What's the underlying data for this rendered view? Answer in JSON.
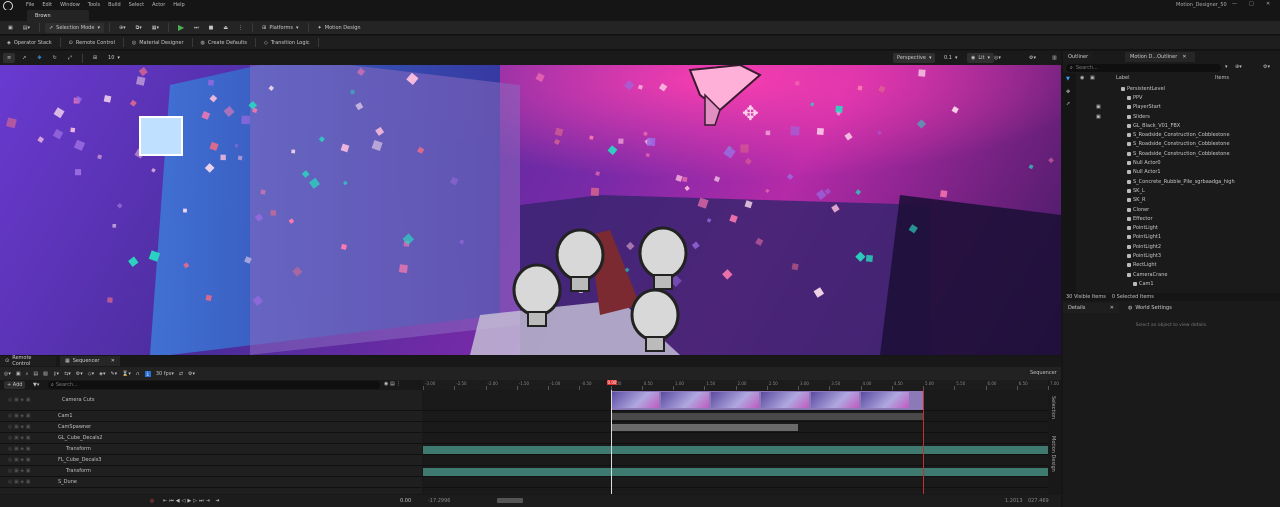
{
  "menu": [
    "File",
    "Edit",
    "Window",
    "Tools",
    "Build",
    "Select",
    "Actor",
    "Help"
  ],
  "window_title": "Motion_Designer_50",
  "doc_tab": "Brown",
  "toolbar": {
    "selection_mode": "Selection Mode",
    "platforms": "Platforms",
    "motion_design": "Motion Design"
  },
  "toolbar2": [
    "Operator Stack",
    "Remote Control",
    "Material Designer",
    "Create Defaults",
    "Transition Logic"
  ],
  "viewport": {
    "perspective": "Perspective",
    "lit": "Lit",
    "fov": "0.1",
    "grid": "10"
  },
  "outliner": {
    "tabs": [
      "Outliner",
      "Motion D...Outliner"
    ],
    "search_placeholder": "Search...",
    "col_label": "Label",
    "col_items": "Items",
    "items": [
      {
        "label": "PersistentLevel",
        "indent": 0
      },
      {
        "label": "PPV",
        "indent": 1
      },
      {
        "label": "PlayerStart",
        "indent": 1
      },
      {
        "label": "Sliders",
        "indent": 1
      },
      {
        "label": "GL_Black_V01_FBX",
        "indent": 1
      },
      {
        "label": "S_Roadside_Construction_Cobblestone",
        "indent": 1
      },
      {
        "label": "S_Roadside_Construction_Cobblestone",
        "indent": 1
      },
      {
        "label": "S_Roadside_Construction_Cobblestone",
        "indent": 1
      },
      {
        "label": "Null Actor0",
        "indent": 1
      },
      {
        "label": "Null Actor1",
        "indent": 1
      },
      {
        "label": "S_Concrete_Rubble_Pile_sgrbaadga_high",
        "indent": 1
      },
      {
        "label": "SK_L",
        "indent": 1
      },
      {
        "label": "SK_R",
        "indent": 1
      },
      {
        "label": "Cloner",
        "indent": 1
      },
      {
        "label": "Effector",
        "indent": 1
      },
      {
        "label": "PointLight",
        "indent": 1
      },
      {
        "label": "PointLight1",
        "indent": 1
      },
      {
        "label": "PointLight2",
        "indent": 1
      },
      {
        "label": "PointLight3",
        "indent": 1
      },
      {
        "label": "RectLight",
        "indent": 1
      },
      {
        "label": "CameraCrane",
        "indent": 1
      },
      {
        "label": "Cam1",
        "indent": 2
      }
    ],
    "visible_items": "30 Visible Items",
    "selected_items": "0 Selected Items"
  },
  "details": {
    "tabs": [
      "Details",
      "World Settings"
    ],
    "empty": "Select an object to view details."
  },
  "bottom_tabs": [
    "Remote Control",
    "Sequencer"
  ],
  "sequencer": {
    "label": "Sequencer",
    "fps": "30 fps",
    "add": "+ Add",
    "search_placeholder": "Search...",
    "time_left": "0.00",
    "range_start": "-17.2996",
    "range_end_a": "1.2013",
    "range_end_b": "027.469",
    "playhead": "0.00",
    "ticks": [
      "-3.00",
      "-2.50",
      "-2.00",
      "-1.50",
      "-1.00",
      "-0.50",
      "0.00",
      "0.50",
      "1.00",
      "1.50",
      "2.00",
      "2.50",
      "3.00",
      "3.50",
      "4.00",
      "4.50",
      "5.00",
      "5.50",
      "6.00",
      "6.50",
      "7.00"
    ],
    "tracks": [
      "Camera Cuts",
      "Cam1",
      "CamSpawner",
      "GL_Cube_Decals2",
      "Transform",
      "FL_Cube_Decals3",
      "Transform",
      "S_Dune"
    ],
    "side": [
      "Selection",
      "Motion Design"
    ]
  }
}
